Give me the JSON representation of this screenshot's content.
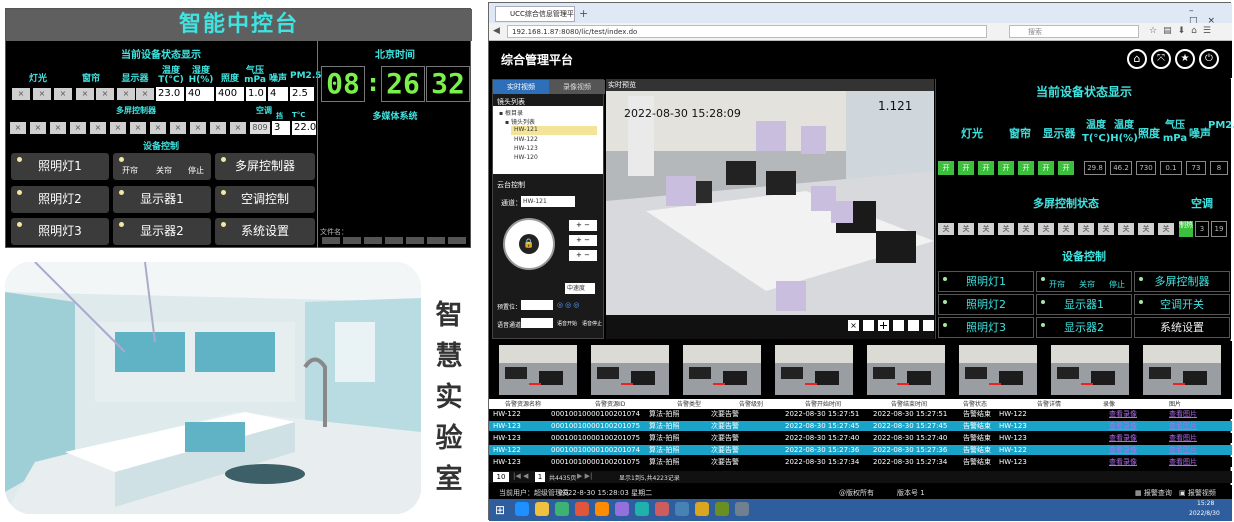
{
  "control": {
    "title": "智能中控台",
    "status_title": "当前设备状态显示",
    "col_light": "灯光",
    "col_curtain": "窗帘",
    "col_display": "显示器",
    "col_temp": "温度T(°C)",
    "col_hum": "湿度H(%)",
    "col_illum": "照度",
    "col_pressure": "气压mPa",
    "col_noise": "噪声",
    "col_pm": "PM2.5",
    "x_mark": "×",
    "val_temp": "23.0",
    "val_hum": "40",
    "val_illum": "400",
    "val_pressure": "1.0",
    "val_noise": "4",
    "val_pm": "2.5",
    "multi_title": "多屏控制器",
    "ac_title": "空调",
    "ac_mode": "挡",
    "ac_temp_label": "T°C",
    "ac_small": "809",
    "ac_mode_val": "3",
    "ac_temp_val": "22.0",
    "device_title": "设备控制",
    "btn_light1": "照明灯1",
    "btn_open": "开帘",
    "btn_close": "关帘",
    "btn_stop": "停止",
    "btn_multi": "多屏控制器",
    "btn_light2": "照明灯2",
    "btn_disp1": "显示器1",
    "btn_ac": "空调控制",
    "btn_light3": "照明灯3",
    "btn_disp2": "显示器2",
    "btn_sys": "系统设置",
    "beijing_time": "北京时间",
    "clock_h": "08",
    "clock_m": "26",
    "clock_s": "32",
    "colon": ":",
    "media_title": "多媒体系统",
    "file_label": "文件名："
  },
  "caption": [
    "智",
    "慧",
    "实",
    "验",
    "室"
  ],
  "browser": {
    "tab_title": "UCC综合信息管理平台",
    "address": "192.168.1.87:8080/lic/test/index.do",
    "search_placeholder": "搜索",
    "app_title": "综合管理平台",
    "tab_realtime": "实时视频",
    "tab_record": "录像视频",
    "cam_list_title": "镜头列表",
    "tree_root": "根目录",
    "tree_group": "镜头列表",
    "cams": [
      "HW-121",
      "HW-122",
      "HW-123",
      "HW-120"
    ],
    "ptz_title": "云台控制",
    "channel_label": "通道：",
    "channel_val": "HW-121",
    "speed_val": "中速度",
    "preset_label": "预置位：",
    "voice_label": "语音通道：",
    "voice_start": "语音开始",
    "voice_stop": "语音停止",
    "video_title": "实时预览",
    "overlay_time": "2022-08-30 15:28:09",
    "overlay_id": "1.121",
    "status_title": "当前设备状态显示",
    "col_light": "灯光",
    "col_curtain": "窗帘",
    "col_display": "显示器",
    "col_temp": "温度T(°C)",
    "col_hum": "温度H(%)",
    "col_illum": "照度",
    "col_pressure": "气压mPa",
    "col_noise": "噪声",
    "col_pm": "PM2.5",
    "on_mark": "开",
    "off_mark": "关",
    "val_temp": "29.8",
    "val_hum": "46.2",
    "val_illum": "730",
    "val_pressure": "0.1",
    "val_noise": "73",
    "val_pm": "8",
    "multi_status": "多屏控制状态",
    "ac_title": "空调",
    "ac_mode_label": "制热",
    "ac_mode_val": "3",
    "ac_temp_val": "19",
    "device_title": "设备控制",
    "btn_light1": "照明灯1",
    "btn_open": "开帘",
    "btn_close": "关帘",
    "btn_stop": "停止",
    "btn_multi": "多屏控制器",
    "btn_light2": "照明灯2",
    "btn_disp1": "显示器1",
    "btn_ac": "空调开关",
    "btn_light3": "照明灯3",
    "btn_disp2": "显示器2",
    "btn_sys": "系统设置",
    "table_headers": [
      "告警资源名称",
      "告警资源ID",
      "告警类型",
      "告警级别",
      "告警开始时间",
      "告警结束时间",
      "告警状态",
      "告警详情",
      "录像",
      "图片"
    ],
    "rows": [
      {
        "name": "HW-122",
        "id": "00010010000100201074",
        "type": "算法-拍照",
        "level": "次要告警",
        "start": "2022-08-30 15:27:51",
        "end": "2022-08-30 15:27:51",
        "state": "告警结束",
        "detail": "HW-122",
        "video": "查看录像",
        "img": "查看图片"
      },
      {
        "name": "HW-123",
        "id": "00010010000100201075",
        "type": "算法-拍照",
        "level": "次要告警",
        "start": "2022-08-30 15:27:45",
        "end": "2022-08-30 15:27:45",
        "state": "告警结束",
        "detail": "HW-123",
        "video": "查看录像",
        "img": "查看图片"
      },
      {
        "name": "HW-123",
        "id": "00010010000100201075",
        "type": "算法-拍照",
        "level": "次要告警",
        "start": "2022-08-30 15:27:40",
        "end": "2022-08-30 15:27:40",
        "state": "告警结束",
        "detail": "HW-123",
        "video": "查看录像",
        "img": "查看图片"
      },
      {
        "name": "HW-122",
        "id": "00010010000100201074",
        "type": "算法-拍照",
        "level": "次要告警",
        "start": "2022-08-30 15:27:36",
        "end": "2022-08-30 15:27:36",
        "state": "告警结束",
        "detail": "HW-122",
        "video": "查看录像",
        "img": "查看图片"
      },
      {
        "name": "HW-123",
        "id": "00010010000100201075",
        "type": "算法-拍照",
        "level": "次要告警",
        "start": "2022-08-30 15:27:34",
        "end": "2022-08-30 15:27:34",
        "state": "告警结束",
        "detail": "HW-123",
        "video": "查看录像",
        "img": "查看图片"
      }
    ],
    "pager_current": "1",
    "pager_total": "共4435页",
    "pager_info": "显示1到5,共4223记录",
    "footer_user": "当前用户：超级管理员",
    "footer_time": "2022-8-30  15:28:03  星期二",
    "footer_copy": "@版权所有",
    "footer_version": "版本号 1",
    "footer_alarm_query": "报警查询",
    "footer_alarm_video": "报警视频",
    "clock_time": "15:28",
    "clock_date": "2022/8/30"
  },
  "colors": {
    "cyan": "#3fe3e0",
    "green": "#7cf04a",
    "onGreen": "#3cbf3c",
    "rowBlue": "#1aa3c8"
  }
}
